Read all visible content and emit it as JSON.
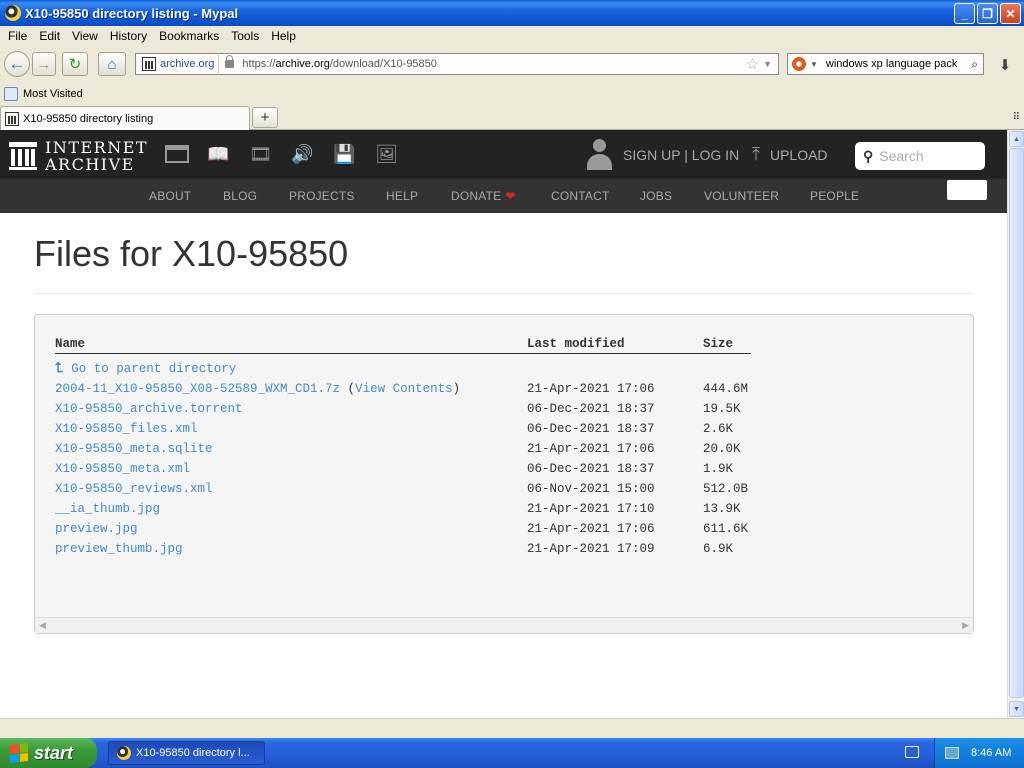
{
  "window": {
    "title": "X10-95850 directory listing - Mypal",
    "buttons": [
      "_",
      "❐",
      "✕"
    ]
  },
  "menu": [
    "File",
    "Edit",
    "View",
    "History",
    "Bookmarks",
    "Tools",
    "Help"
  ],
  "navbar": {
    "identity": "archive.org",
    "url_prefix": "https://",
    "url_host": "archive.org",
    "url_path": "/download/X10-95850",
    "search_text": "windows xp language pack"
  },
  "bookmarks": {
    "most_visited": "Most Visited"
  },
  "tab": {
    "label": "X10-95850 directory listing",
    "new_tab": "+"
  },
  "ia": {
    "logo_line1": "INTERNET",
    "logo_line2": "ARCHIVE",
    "signup": "SIGN UP | LOG IN",
    "upload": "UPLOAD",
    "search_placeholder": "Search",
    "nav": [
      "ABOUT",
      "BLOG",
      "PROJECTS",
      "HELP",
      "DONATE",
      "CONTACT",
      "JOBS",
      "VOLUNTEER",
      "PEOPLE"
    ]
  },
  "page": {
    "title": "Files for X10-95850",
    "columns": {
      "name": "Name",
      "modified": "Last modified",
      "size": "Size"
    },
    "parent": "Go to parent directory",
    "files": [
      {
        "name": "2004-11_X10-95850_X08-52589_WXM_CD1.7z",
        "extra": "View Contents",
        "date": "21-Apr-2021 17:06",
        "size": "444.6M"
      },
      {
        "name": "X10-95850_archive.torrent",
        "date": "06-Dec-2021 18:37",
        "size": "19.5K"
      },
      {
        "name": "X10-95850_files.xml",
        "date": "06-Dec-2021 18:37",
        "size": "2.6K"
      },
      {
        "name": "X10-95850_meta.sqlite",
        "date": "21-Apr-2021 17:06",
        "size": "20.0K"
      },
      {
        "name": "X10-95850_meta.xml",
        "date": "06-Dec-2021 18:37",
        "size": "1.9K"
      },
      {
        "name": "X10-95850_reviews.xml",
        "date": "06-Nov-2021 15:00",
        "size": "512.0B"
      },
      {
        "name": "__ia_thumb.jpg",
        "date": "21-Apr-2021 17:10",
        "size": "13.9K"
      },
      {
        "name": "preview.jpg",
        "date": "21-Apr-2021 17:06",
        "size": "611.6K"
      },
      {
        "name": "preview_thumb.jpg",
        "date": "21-Apr-2021 17:09",
        "size": "6.9K"
      }
    ]
  },
  "taskbar": {
    "start": "start",
    "task": "X10-95850 directory l...",
    "clock": "8:46 AM"
  },
  "colors": {
    "link": "#428bca",
    "ia_header": "#232323",
    "ia_nav": "#333333",
    "xp_blue": "#245fd8",
    "start_green": "#3a9a3a"
  }
}
